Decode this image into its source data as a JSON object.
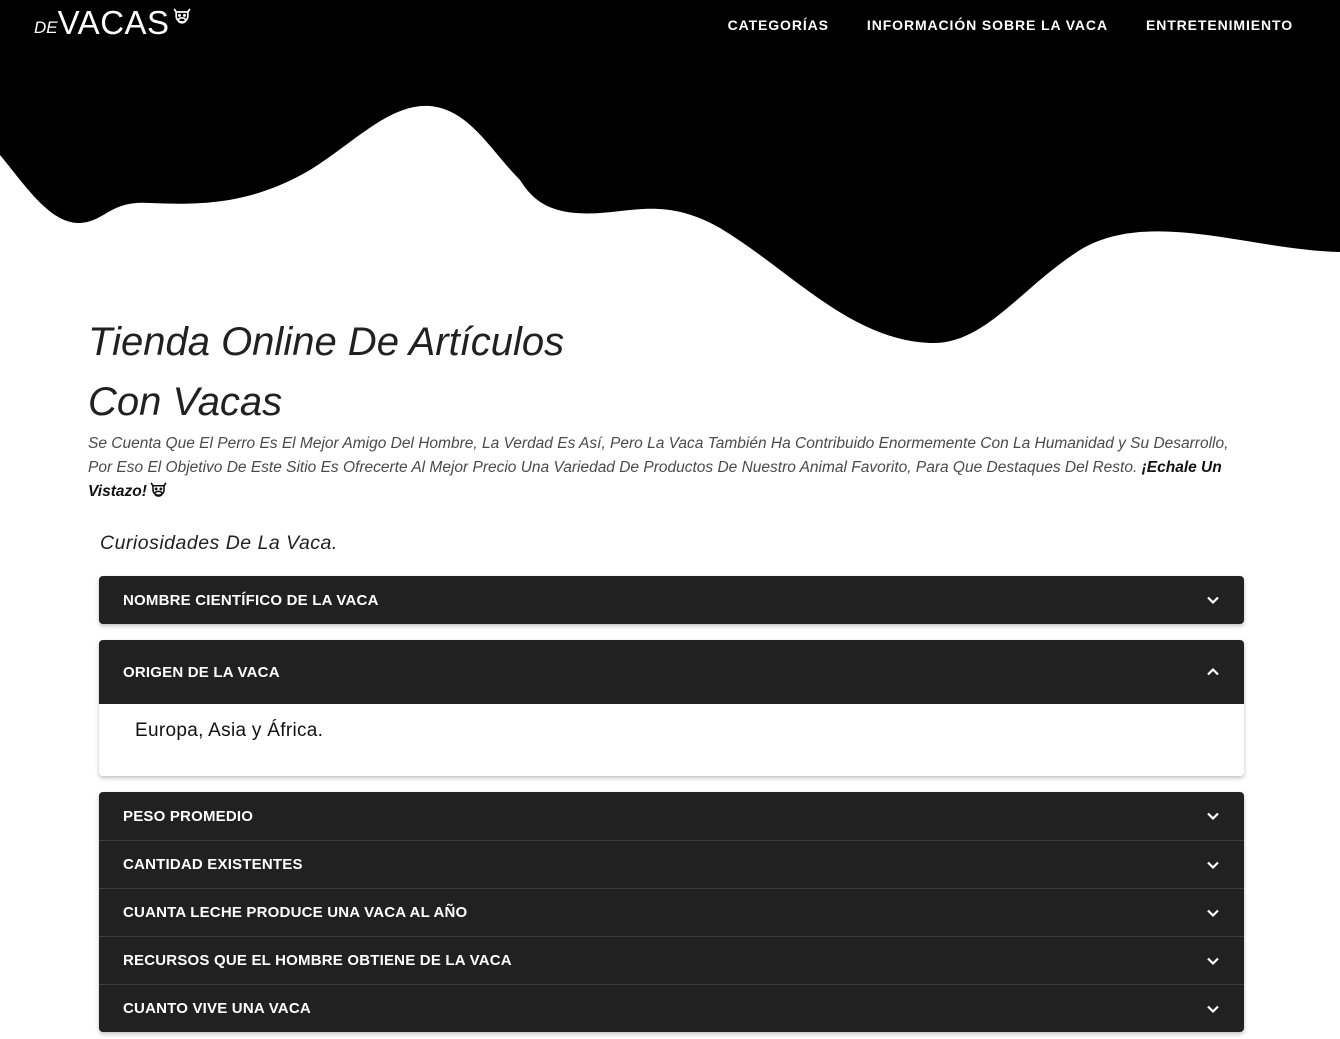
{
  "brand": {
    "prefix": "DE",
    "name": "VACAS",
    "icon": "cow-face-icon"
  },
  "nav": {
    "links": [
      "CATEGORÍAS",
      "INFORMACIÓN SOBRE LA VACA",
      "ENTRETENIMIENTO"
    ]
  },
  "hero": {
    "title": "Tienda Online De Artículos Con Vacas",
    "lead_text": "Se Cuenta Que El Perro Es El Mejor Amigo Del Hombre, La Verdad Es Así, Pero La Vaca También Ha Contribuido Enormemente Con La Humanidad y Su Desarrollo, Por Eso El Objetivo De Este Sitio Es Ofrecerte Al Mejor Precio Una Variedad De Productos De Nuestro Animal Favorito, Para Que Destaques Del Resto.",
    "lead_cta": "¡Echale Un Vistazo!",
    "lead_icon": "cow-face-icon"
  },
  "curiosities": {
    "heading": "Curiosidades De La Vaca.",
    "items": [
      {
        "title": "NOMBRE CIENTÍFICO DE LA VACA",
        "expanded": false
      },
      {
        "title": "ORIGEN DE LA VACA",
        "expanded": true,
        "content": "Europa, Asia y África."
      },
      {
        "title": "PESO PROMEDIO",
        "expanded": false
      },
      {
        "title": "CANTIDAD EXISTENTES",
        "expanded": false
      },
      {
        "title": "CUANTA LECHE PRODUCE UNA VACA AL AÑO",
        "expanded": false
      },
      {
        "title": "RECURSOS QUE EL HOMBRE OBTIENE DE LA VACA",
        "expanded": false
      },
      {
        "title": "CUANTO VIVE UNA VACA",
        "expanded": false
      }
    ]
  },
  "colors": {
    "hero_black": "#000000",
    "panel_dark": "#212121",
    "background": "#ffffff"
  }
}
